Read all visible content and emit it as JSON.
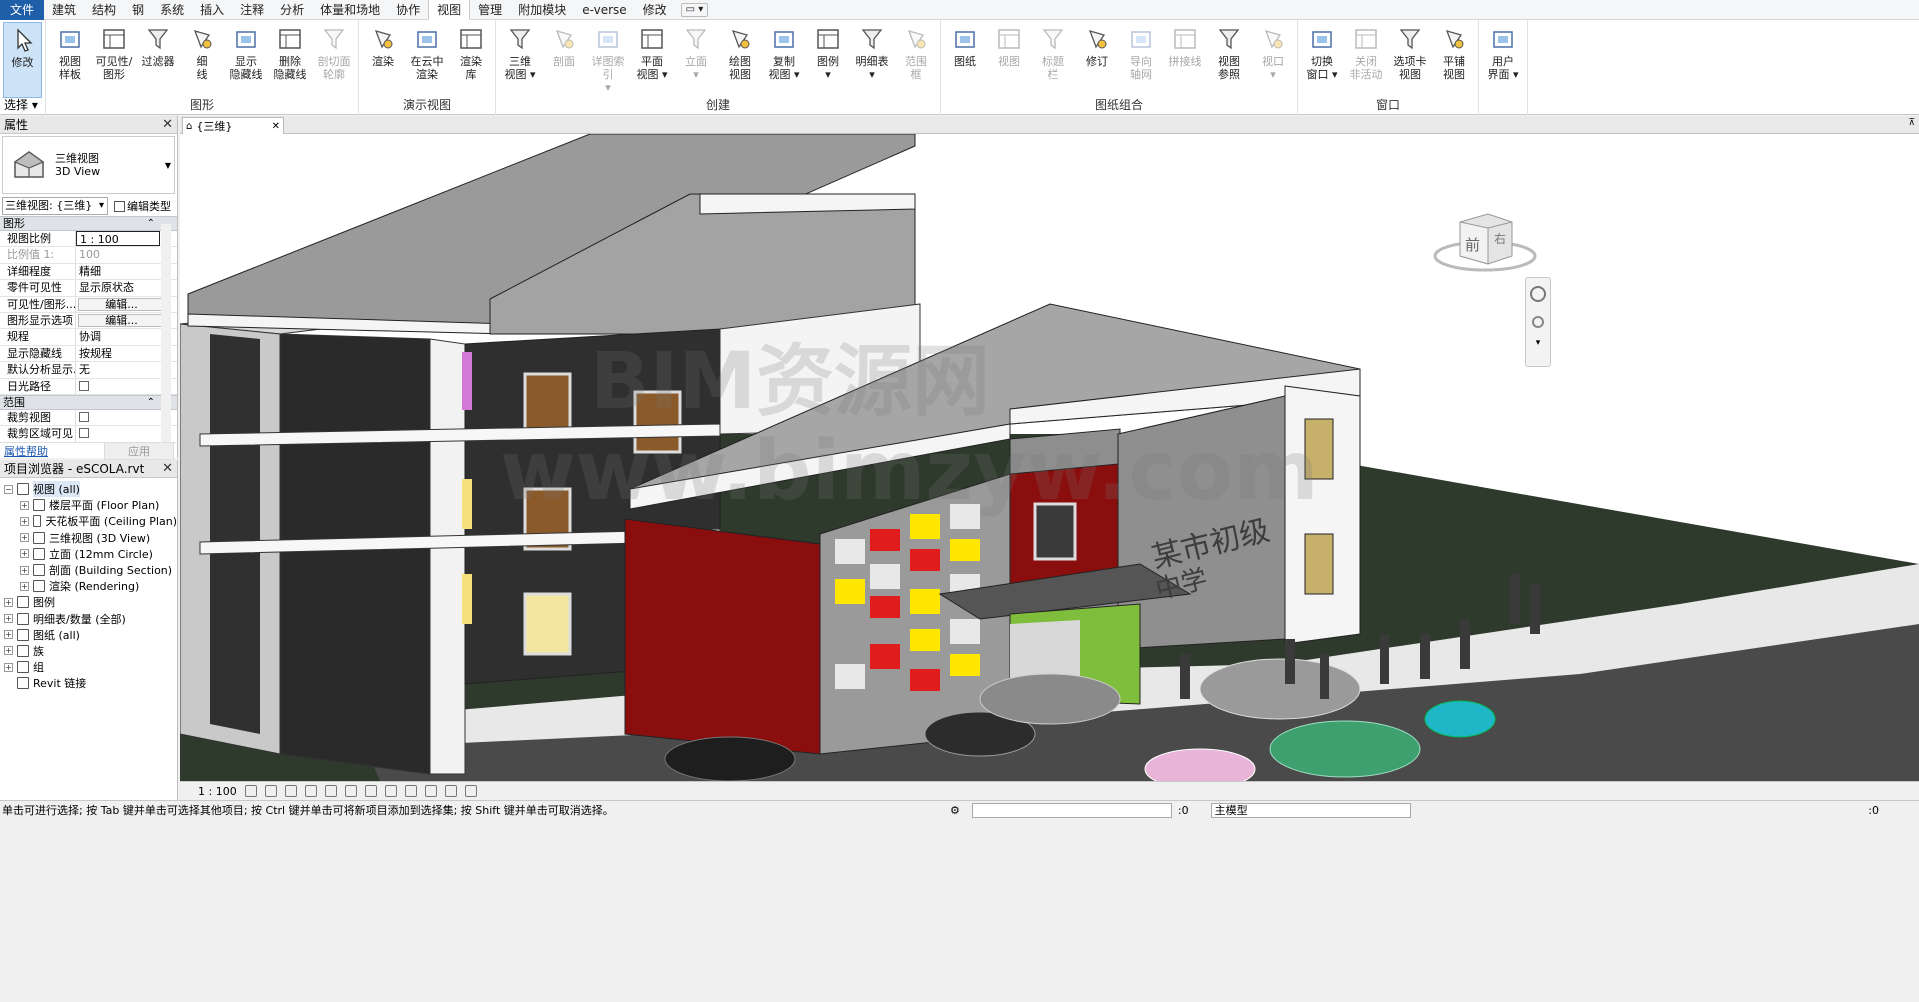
{
  "menu": {
    "tabs": [
      "文件",
      "建筑",
      "结构",
      "钢",
      "系统",
      "插入",
      "注释",
      "分析",
      "体量和场地",
      "协作",
      "视图",
      "管理",
      "附加模块",
      "e-verse",
      "修改"
    ],
    "active_index": 10
  },
  "ribbon": {
    "select_label": "选择 ▾",
    "panels": [
      {
        "title": "",
        "buttons": [
          {
            "label": "修改",
            "icon": "arrow-cursor-icon",
            "selected": true
          }
        ]
      },
      {
        "title": "图形",
        "buttons": [
          {
            "label": "视图\n样板",
            "icon": "view-template-icon"
          },
          {
            "label": "可见性/\n图形",
            "icon": "visibility-graphics-icon"
          },
          {
            "label": "过滤器",
            "icon": "filter-icon"
          },
          {
            "label": "细\n线",
            "icon": "thin-lines-icon"
          },
          {
            "label": "显示\n隐藏线",
            "icon": "show-hidden-lines-icon"
          },
          {
            "label": "删除\n隐藏线",
            "icon": "remove-hidden-lines-icon"
          },
          {
            "label": "剖切面\n轮廓",
            "icon": "cut-profile-icon",
            "disabled": true
          }
        ]
      },
      {
        "title": "演示视图",
        "buttons": [
          {
            "label": "渲染",
            "icon": "render-teapot-icon"
          },
          {
            "label": "在云中\n渲染",
            "icon": "cloud-render-icon"
          },
          {
            "label": "渲染\n库",
            "icon": "render-gallery-icon"
          }
        ]
      },
      {
        "title": "创建",
        "buttons": [
          {
            "label": "三维\n视图 ▾",
            "icon": "house-3d-icon"
          },
          {
            "label": "剖面",
            "icon": "section-icon",
            "disabled": true
          },
          {
            "label": "详图索引\n▾",
            "icon": "callout-icon",
            "disabled": true
          },
          {
            "label": "平面\n视图 ▾",
            "icon": "plan-view-icon"
          },
          {
            "label": "立面\n▾",
            "icon": "elevation-icon",
            "disabled": true
          },
          {
            "label": "绘图\n视图",
            "icon": "drafting-view-icon"
          },
          {
            "label": "复制\n视图 ▾",
            "icon": "duplicate-view-icon"
          },
          {
            "label": "图例\n▾",
            "icon": "legend-icon"
          },
          {
            "label": "明细表\n▾",
            "icon": "schedule-icon"
          },
          {
            "label": "范围\n框",
            "icon": "scope-box-icon",
            "disabled": true
          }
        ]
      },
      {
        "title": "图纸组合",
        "buttons": [
          {
            "label": "图纸",
            "icon": "sheet-icon"
          },
          {
            "label": "视图",
            "icon": "place-view-icon",
            "disabled": true
          },
          {
            "label": "标题\n栏",
            "icon": "title-block-icon",
            "disabled": true
          },
          {
            "label": "修订",
            "icon": "revisions-icon"
          },
          {
            "label": "导向\n轴网",
            "icon": "guide-grid-icon",
            "disabled": true
          },
          {
            "label": "拼接线",
            "icon": "matchline-icon",
            "disabled": true
          },
          {
            "label": "视图\n参照",
            "icon": "view-reference-icon"
          },
          {
            "label": "视口\n▾",
            "icon": "viewport-icon",
            "disabled": true
          }
        ]
      },
      {
        "title": "窗口",
        "buttons": [
          {
            "label": "切换\n窗口 ▾",
            "icon": "switch-windows-icon"
          },
          {
            "label": "关闭\n非活动",
            "icon": "close-inactive-icon",
            "disabled": true
          },
          {
            "label": "选项卡\n视图",
            "icon": "tab-views-icon"
          },
          {
            "label": "平铺\n视图",
            "icon": "tile-views-icon"
          }
        ]
      },
      {
        "title": "",
        "buttons": [
          {
            "label": "用户\n界面 ▾",
            "icon": "user-interface-icon"
          }
        ]
      }
    ]
  },
  "properties": {
    "title": "属性",
    "type_name": "三维视图",
    "type_name_en": "3D View",
    "instance_selector": "三维视图: {三维}",
    "edit_type": "编辑类型",
    "groups": [
      {
        "name": "图形",
        "rows": [
          {
            "k": "视图比例",
            "v": "1 : 100",
            "style": "boxed"
          },
          {
            "k": "比例值 1:",
            "v": "100",
            "style": "dim"
          },
          {
            "k": "详细程度",
            "v": "精细"
          },
          {
            "k": "零件可见性",
            "v": "显示原状态"
          },
          {
            "k": "可见性/图形...",
            "v": "编辑...",
            "style": "btn"
          },
          {
            "k": "图形显示选项",
            "v": "编辑...",
            "style": "btn"
          },
          {
            "k": "规程",
            "v": "协调"
          },
          {
            "k": "显示隐藏线",
            "v": "按规程"
          },
          {
            "k": "默认分析显示...",
            "v": "无"
          },
          {
            "k": "日光路径",
            "v": "",
            "style": "check"
          }
        ]
      },
      {
        "name": "范围",
        "rows": [
          {
            "k": "裁剪视图",
            "v": "",
            "style": "check"
          },
          {
            "k": "裁剪区域可见",
            "v": "",
            "style": "check"
          }
        ]
      }
    ],
    "help_link": "属性帮助",
    "apply_label": "应用"
  },
  "browser": {
    "title": "项目浏览器 - eSCOLA.rvt",
    "items": [
      {
        "label": "视图 (all)",
        "level": 0,
        "tog": "−",
        "hl": true
      },
      {
        "label": "楼层平面 (Floor Plan)",
        "level": 1,
        "tog": "+"
      },
      {
        "label": "天花板平面 (Ceiling Plan)",
        "level": 1,
        "tog": "+"
      },
      {
        "label": "三维视图 (3D View)",
        "level": 1,
        "tog": "+"
      },
      {
        "label": "立面 (12mm Circle)",
        "level": 1,
        "tog": "+"
      },
      {
        "label": "剖面 (Building Section)",
        "level": 1,
        "tog": "+"
      },
      {
        "label": "渲染 (Rendering)",
        "level": 1,
        "tog": "+"
      },
      {
        "label": "图例",
        "level": 0,
        "tog": "+"
      },
      {
        "label": "明细表/数量 (全部)",
        "level": 0,
        "tog": "+"
      },
      {
        "label": "图纸 (all)",
        "level": 0,
        "tog": "+"
      },
      {
        "label": "族",
        "level": 0,
        "tog": "+"
      },
      {
        "label": "组",
        "level": 0,
        "tog": "+"
      },
      {
        "label": "Revit 链接",
        "level": 0,
        "tog": ""
      }
    ]
  },
  "view": {
    "tab_label": "{三维}",
    "viewcube_front": "前",
    "viewcube_right": "右",
    "sign_text_1": "某市初级",
    "sign_text_2": "中学",
    "watermark_1": "BIM资源网",
    "watermark_2": "www.bimzyw.com"
  },
  "view_control": {
    "scale": "1 : 100"
  },
  "status": {
    "message": "单击可进行选择; 按 Tab 键并单击可选择其他项目; 按 Ctrl 键并单击可将新项目添加到选择集; 按 Shift 键并单击可取消选择。",
    "zero": ":0",
    "model": "主模型",
    "filter": ":0"
  }
}
